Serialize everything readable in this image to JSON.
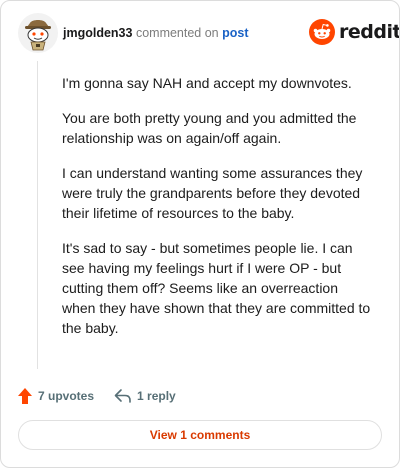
{
  "header": {
    "author": "jmgolden33",
    "commented_text": "commented on",
    "post_link": "post",
    "brand": "reddit",
    "colors": {
      "brand_orange": "#ff4500",
      "link_blue": "#1a62c6"
    }
  },
  "comment": {
    "paragraphs": [
      "I'm gonna say NAH and accept my downvotes.",
      "You are both pretty young and you admitted the relationship was on again/off again.",
      "I can understand wanting some assurances they were truly the grandparents before they devoted their lifetime of resources to the baby.",
      "It's sad to say - but sometimes people lie. I can see having my feelings hurt if I were OP - but cutting them off? Seems like an overreaction when they have shown that they are committed to the baby."
    ]
  },
  "actions": {
    "upvotes_label": "7 upvotes",
    "reply_label": "1 reply",
    "upvote_icon": "upvote-arrow-icon",
    "reply_icon": "reply-arrow-icon",
    "colors": {
      "upvote": "#ff4500",
      "action_text": "#576f76"
    }
  },
  "footer": {
    "view_comments_label": "View 1 comments",
    "color": "#d93a00"
  }
}
